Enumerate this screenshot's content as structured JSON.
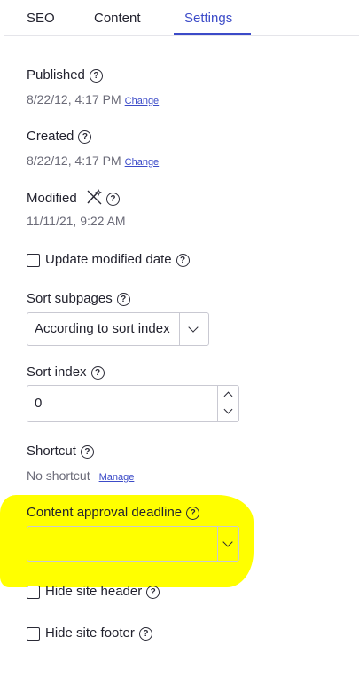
{
  "tabs": [
    {
      "label": "SEO"
    },
    {
      "label": "Content"
    },
    {
      "label": "Settings",
      "active": true
    }
  ],
  "published": {
    "label": "Published",
    "value": "8/22/12, 4:17 PM",
    "change": "Change"
  },
  "created": {
    "label": "Created",
    "value": "8/22/12, 4:17 PM",
    "change": "Change"
  },
  "modified": {
    "label": "Modified",
    "value": "11/11/21, 9:22 AM"
  },
  "update_modified": {
    "label": "Update modified date",
    "checked": false
  },
  "sort_subpages": {
    "label": "Sort subpages",
    "selected": "According to sort index"
  },
  "sort_index": {
    "label": "Sort index",
    "value": "0"
  },
  "shortcut": {
    "label": "Shortcut",
    "value": "No shortcut",
    "manage": "Manage"
  },
  "content_approval": {
    "label": "Content approval deadline",
    "selected": ""
  },
  "hide_header": {
    "label": "Hide site header",
    "checked": false
  },
  "hide_footer": {
    "label": "Hide site footer",
    "checked": false
  },
  "colors": {
    "accent": "#3c4bc8",
    "highlight": "#ffff00"
  }
}
